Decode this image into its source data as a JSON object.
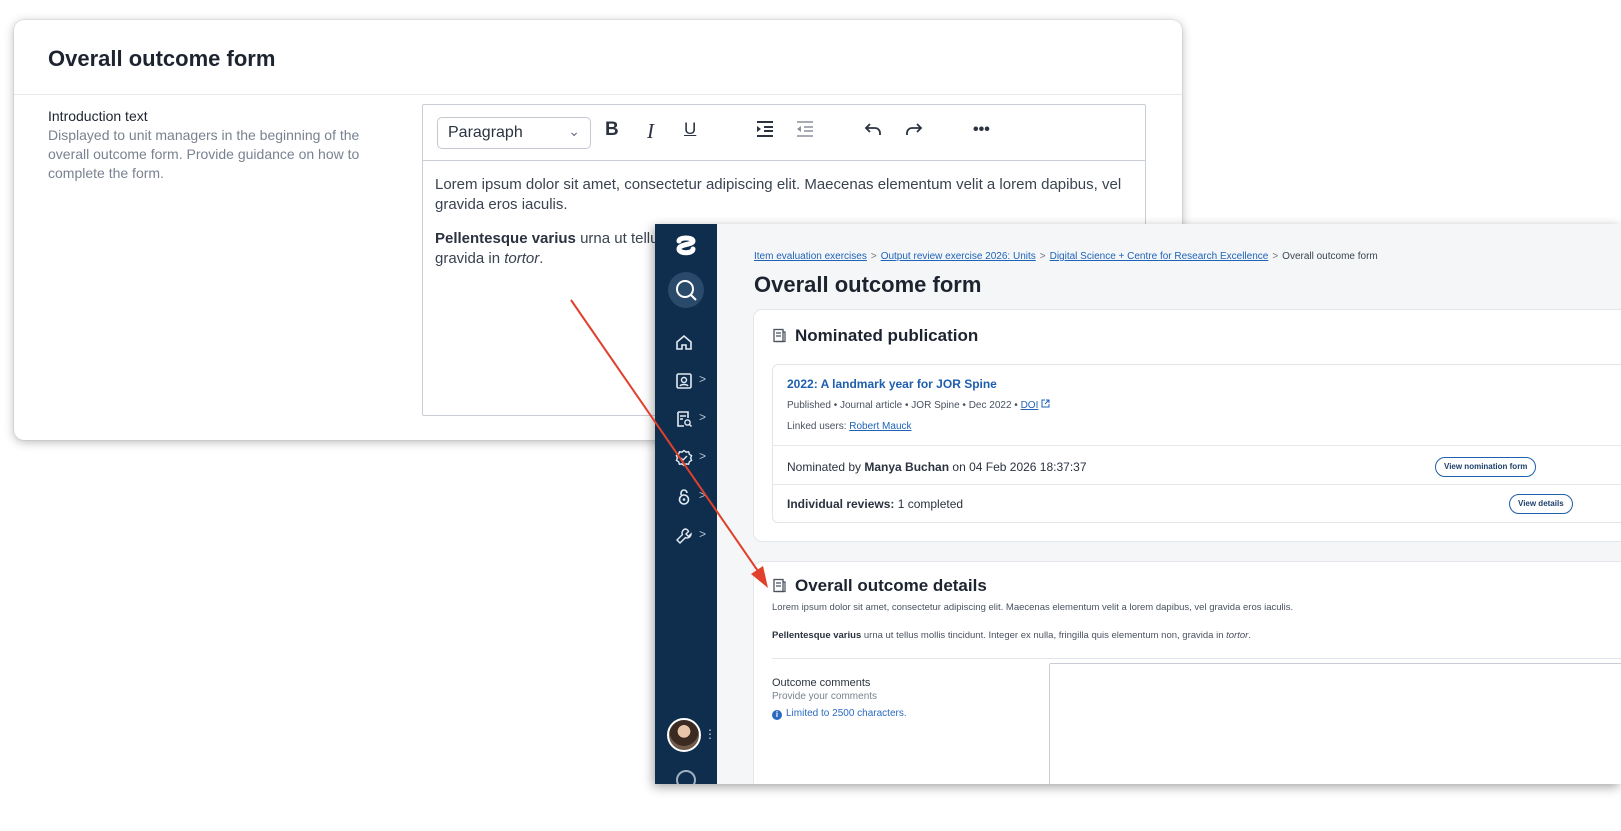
{
  "back_form": {
    "title": "Overall outcome form",
    "intro_label": "Introduction text",
    "intro_help": "Displayed to unit managers in the beginning of the overall outcome form. Provide guidance on how to complete the form.",
    "toolbar": {
      "paragraph_select": "Paragraph",
      "bold": "B",
      "italic": "I",
      "underline": "U",
      "more": "•••"
    },
    "editor_para1": "Lorem ipsum dolor sit amet, consectetur adipiscing elit. Maecenas elementum velit a lorem dapibus, vel gravida eros iaculis.",
    "editor_para2_bold": "Pellentesque varius",
    "editor_para2_rest": " urna ut tellus mollis tincidunt. Integer ex nulla, fringilla quis elementum non, gravida in ",
    "editor_para2_italic": "tortor",
    "editor_para2_end": "."
  },
  "front_window": {
    "breadcrumb": {
      "item1": "Item evaluation exercises",
      "item2": "Output review exercise 2026: Units",
      "item3": "Digital Science + Centre for Research Excellence",
      "current": "Overall outcome form",
      "separator": ">"
    },
    "page_title": "Overall outcome form",
    "nominated": {
      "title": "Nominated publication",
      "pub_title": "2022: A landmark year for JOR Spine",
      "pub_meta": "Published • Journal article • JOR Spine • Dec 2022 • ",
      "doi_label": "DOI",
      "linked_users_label": "Linked users: ",
      "linked_user": "Robert Mauck",
      "nominated_by_prefix": "Nominated by ",
      "nominated_by_name": "Manya Buchan",
      "nominated_by_suffix": " on 04 Feb 2026 18:37:37",
      "view_nomination_button": "View nomination form",
      "reviews_label": "Individual reviews:",
      "reviews_value": " 1 completed",
      "view_details_button": "View details"
    },
    "outcome": {
      "title": "Overall outcome details",
      "para1": "Lorem ipsum dolor sit amet, consectetur adipiscing elit. Maecenas elementum velit a lorem dapibus, vel gravida eros iaculis.",
      "para2_bold": "Pellentesque varius",
      "para2_rest": " urna ut tellus mollis tincidunt. Integer ex nulla, fringilla quis elementum non, gravida in ",
      "para2_italic": "tortor",
      "para2_end": ".",
      "comments_label": "Outcome comments",
      "comments_help": "Provide your comments",
      "comments_limit": "Limited to 2500 characters."
    }
  },
  "colors": {
    "nav_bg": "#0f2e4d",
    "link": "#1e63b8",
    "arrow": "#e0402c"
  }
}
